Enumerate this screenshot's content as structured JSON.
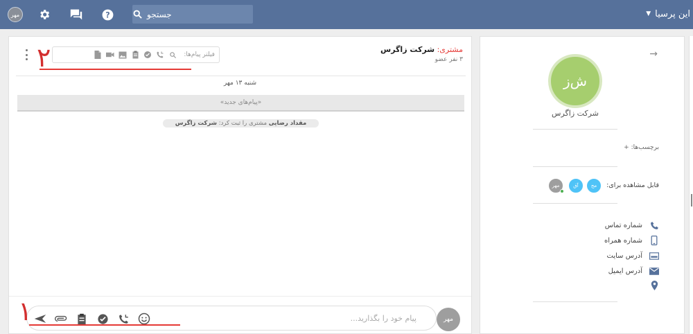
{
  "topbar": {
    "user_avatar_initials": "مهر",
    "search_placeholder": "جستجو",
    "workspace_name": "این پرسیا",
    "icons": [
      "gear-icon",
      "chat-icon",
      "help-icon",
      "search-icon",
      "caret-down-icon"
    ]
  },
  "chat": {
    "customer_key": "مشتری:",
    "customer_name": "شرکت زاگرس",
    "members": "۳ نفر عضو",
    "filter_label": "فیلتر پیام‌ها:",
    "annotation_top": "۲",
    "date_label": "شنبه ۱۳ مهر",
    "new_messages": "«پیام‌های جدید»",
    "system_message_prefix": "مقداد رضایی",
    "system_message_mid": " مشتری را ثبت کرد: ",
    "system_message_company": "شرکت زاگرس",
    "composer_placeholder": "پیام خود را بگذارید...",
    "composer_avatar": "مهر",
    "annotation_bottom": "۱"
  },
  "info": {
    "avatar_initials": "ش‌ز",
    "company_name": "شرکت زاگرس",
    "tags_label": "برچسب‌ها: +",
    "visible_for_label": "قابل مشاهده برای:",
    "visible_avatars": [
      {
        "initials": "مح",
        "color": "#4fc3f7"
      },
      {
        "initials": "آق",
        "color": "#4fc3f7"
      },
      {
        "initials": "مهر",
        "color": "#9e9e9e"
      }
    ],
    "contacts": {
      "phone": "شماره تماس",
      "mobile": "شماره همراه",
      "website": "آدرس سایت",
      "email": "آدرس ایمیل",
      "location": ""
    }
  },
  "colors": {
    "topbar": "#56719b",
    "accent_red": "#e53935",
    "avatar_green": "#a6ce6e"
  }
}
